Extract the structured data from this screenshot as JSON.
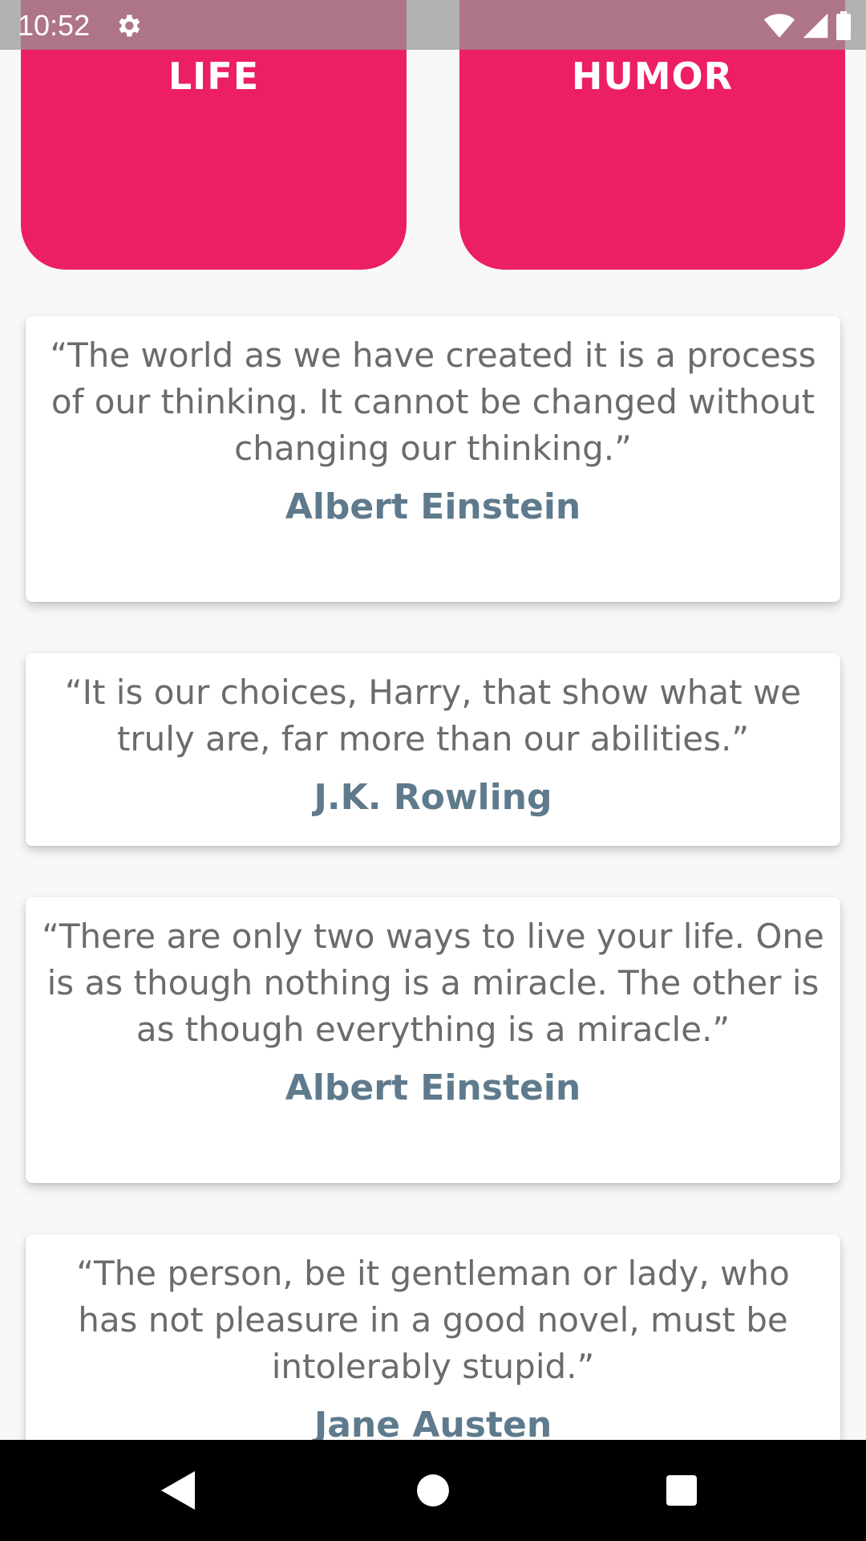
{
  "status_bar": {
    "time": "10:52",
    "icons": [
      "gear-icon",
      "wifi-icon",
      "signal-icon",
      "battery-icon"
    ]
  },
  "categories": [
    {
      "label": "LIFE"
    },
    {
      "label": "HUMOR"
    }
  ],
  "quotes": [
    {
      "text": "“The world as we have created it is a process of our thinking. It cannot be changed without changing our thinking.”",
      "author": "Albert Einstein"
    },
    {
      "text": "“It is our choices, Harry, that show what we truly are, far more than our abilities.”",
      "author": "J.K. Rowling"
    },
    {
      "text": "“There are only two ways to live your life. One is as though nothing is a miracle. The other is as though everything is a miracle.”",
      "author": "Albert Einstein"
    },
    {
      "text": "“The person, be it gentleman or lady, who has not pleasure in a good novel, must be intolerably stupid.”",
      "author": "Jane Austen"
    }
  ],
  "colors": {
    "accent": "#ec1f65",
    "author": "#5e7a8c",
    "quote_text": "#6b6b6b",
    "background": "#f8f8f8"
  },
  "nav_bar": {
    "icons": [
      "back-icon",
      "home-icon",
      "recents-icon"
    ]
  }
}
